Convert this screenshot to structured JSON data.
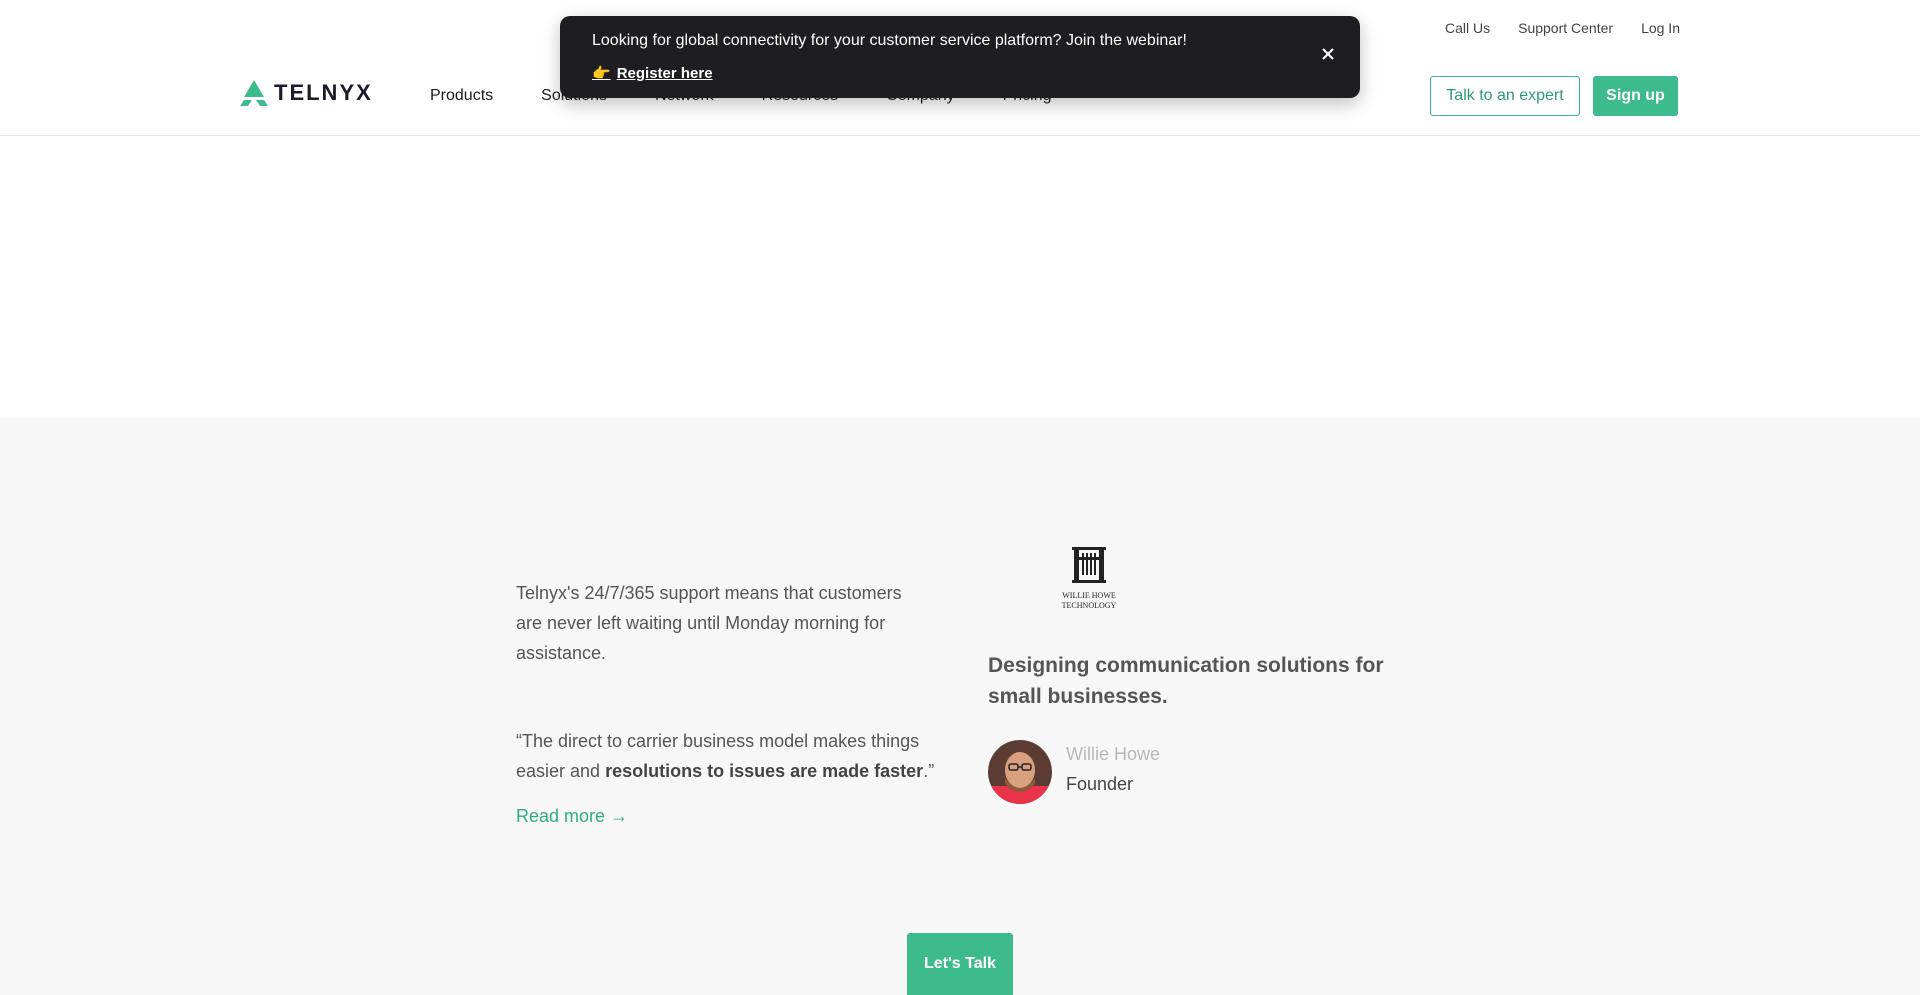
{
  "utility_nav": [
    "Call Us",
    "Support Center",
    "Log In"
  ],
  "logo": {
    "text": "TELNYX"
  },
  "main_nav": [
    "Products",
    "Solutions",
    "Network",
    "Resources",
    "Company",
    "Pricing"
  ],
  "header_buttons": {
    "expert": "Talk to an expert",
    "signup": "Sign up"
  },
  "banner": {
    "text": "Looking for global connectivity for your customer service platform? Join the webinar!",
    "link": "Register here",
    "link_icon": "pointing-hand-emoji",
    "close_icon": "close-icon"
  },
  "testimonial": {
    "intro": "Telnyx's 24/7/365 support means that customers are never left waiting until Monday morning for assistance.",
    "quote_open": "“The direct to carrier business model makes things easier and ",
    "quote_bold": "resolutions to issues are made faster",
    "quote_close": ".”",
    "read_more": "Read more →",
    "company_logo_lines": [
      "WILLIE HOWE",
      "TECHNOLOGY"
    ],
    "tagline": "Designing communication solutions for small businesses.",
    "person_name": "Willie Howe",
    "person_role": "Founder"
  },
  "cta": {
    "label": "Let's Talk"
  },
  "colors": {
    "accent": "#3dbb8c",
    "banner_bg": "#1d1d22",
    "section_bg": "#f7f7f7"
  }
}
